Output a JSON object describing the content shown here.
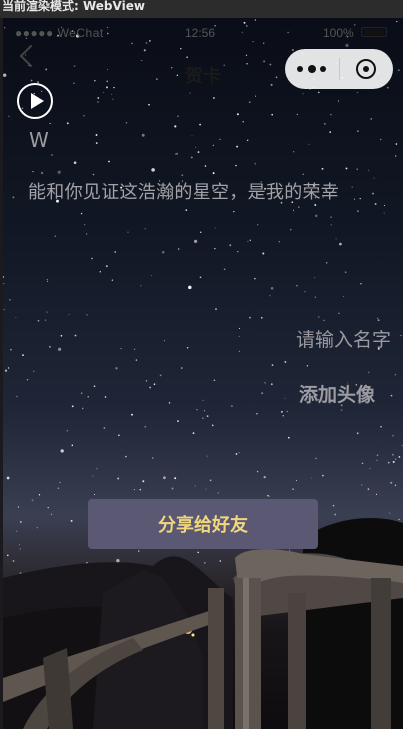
{
  "devtools": {
    "render_mode_label": "当前渲染模式: WebView"
  },
  "status_bar": {
    "carrier": "●●●●● WeChat",
    "time": "12:56",
    "battery_percent": "100%"
  },
  "nav": {
    "title": "贺卡"
  },
  "card": {
    "sender": "W",
    "greeting": "能和你见证这浩瀚的星空，是我的荣幸",
    "name_placeholder": "请输入名字",
    "add_avatar_label": "添加头像",
    "share_label": "分享给好友"
  },
  "colors": {
    "share_button_bg": "#5a5873",
    "share_button_text": "#f0d77d",
    "card_text": "#a2a2a8"
  }
}
